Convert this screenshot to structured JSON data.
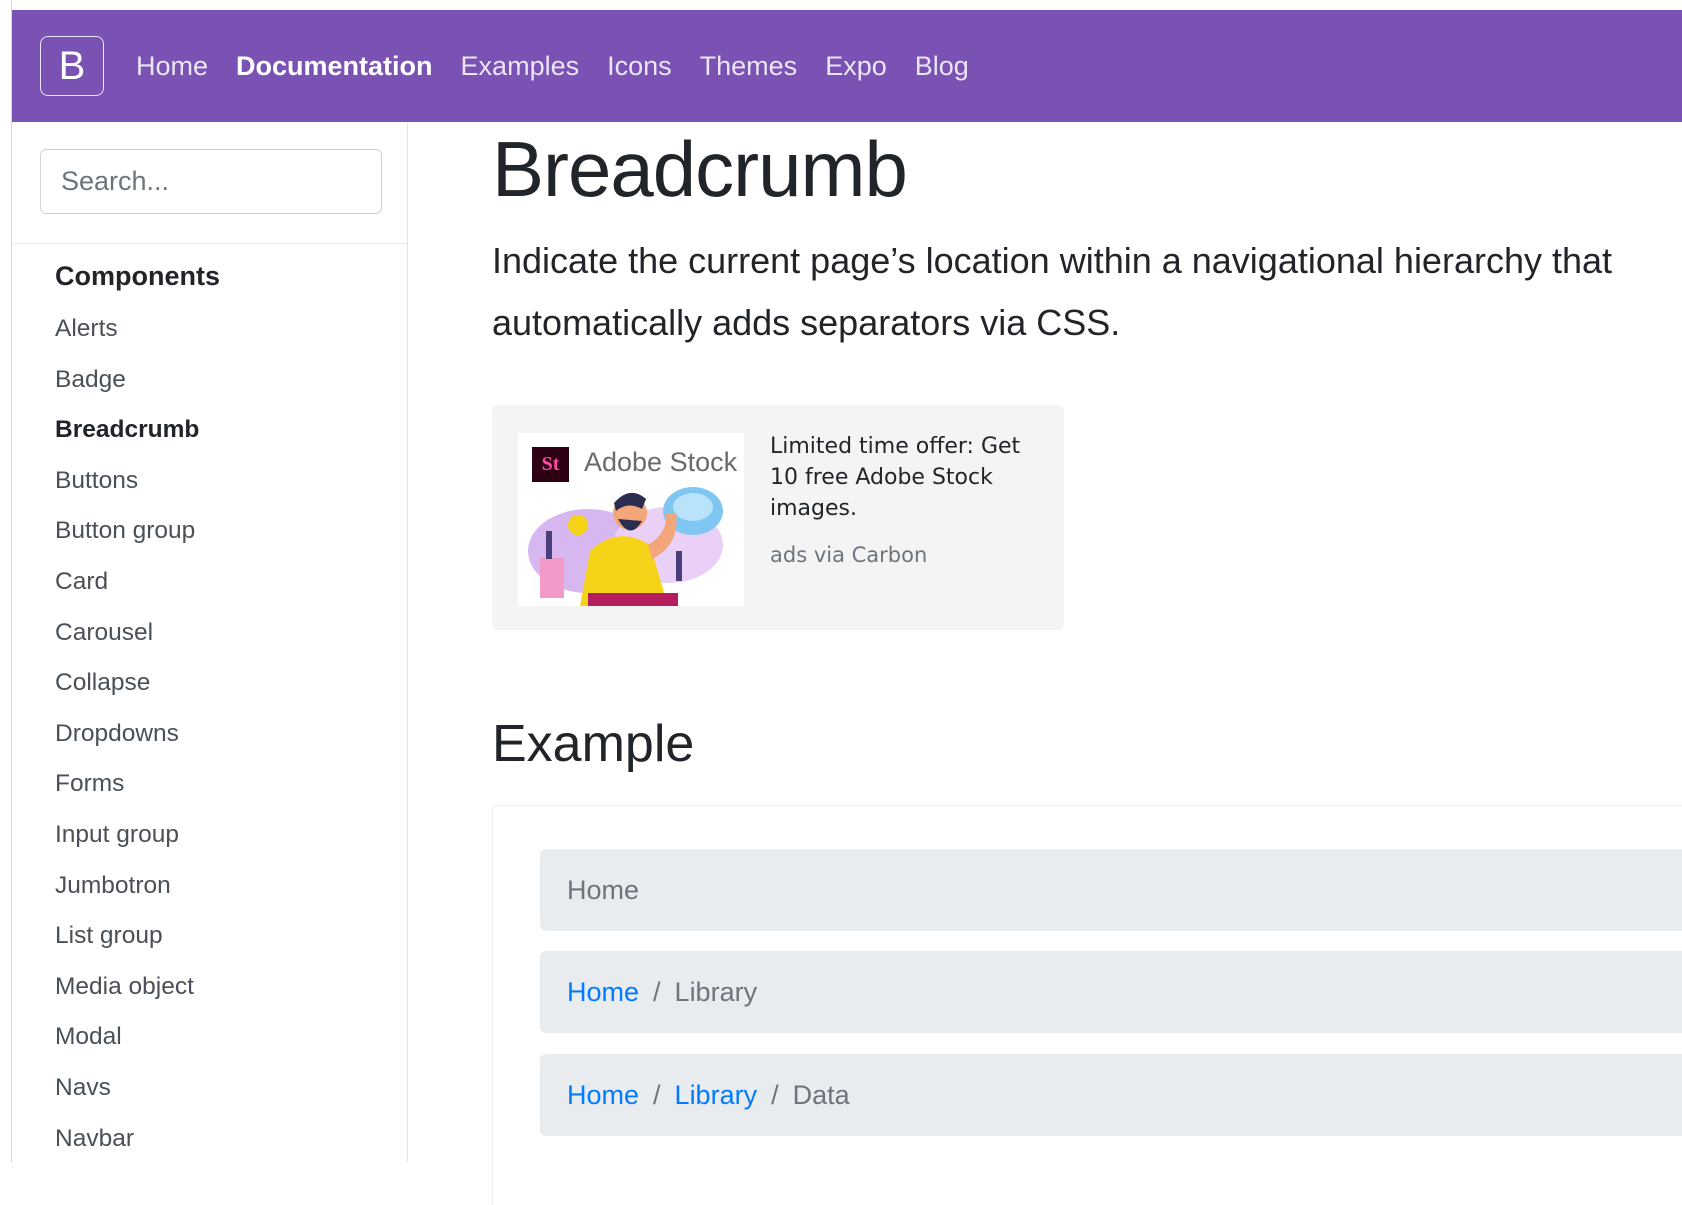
{
  "navbar": {
    "brand": "B",
    "links": [
      {
        "label": "Home",
        "active": false
      },
      {
        "label": "Documentation",
        "active": true
      },
      {
        "label": "Examples",
        "active": false
      },
      {
        "label": "Icons",
        "active": false
      },
      {
        "label": "Themes",
        "active": false
      },
      {
        "label": "Expo",
        "active": false
      },
      {
        "label": "Blog",
        "active": false
      }
    ],
    "color": "#7952b3"
  },
  "sidebar": {
    "search_placeholder": "Search...",
    "heading": "Components",
    "items": [
      "Alerts",
      "Badge",
      "Breadcrumb",
      "Buttons",
      "Button group",
      "Card",
      "Carousel",
      "Collapse",
      "Dropdowns",
      "Forms",
      "Input group",
      "Jumbotron",
      "List group",
      "Media object",
      "Modal",
      "Navs",
      "Navbar"
    ],
    "active_item": "Breadcrumb"
  },
  "main": {
    "title": "Breadcrumb",
    "lead": "Indicate the current page’s location within a navigational hierarchy that automatically adds separators via CSS.",
    "ad": {
      "logo_letters": "St",
      "logo_name": "Adobe Stock",
      "text": "Limited time offer: Get 10 free Adobe Stock images.",
      "powered_by": "ads via Carbon"
    },
    "section_title": "Example",
    "breadcrumbs": [
      {
        "links": [],
        "current": "Home"
      },
      {
        "links": [
          "Home"
        ],
        "current": "Library"
      },
      {
        "links": [
          "Home",
          "Library"
        ],
        "current": "Data"
      }
    ],
    "separator": "/",
    "link_color": "#007bff"
  }
}
